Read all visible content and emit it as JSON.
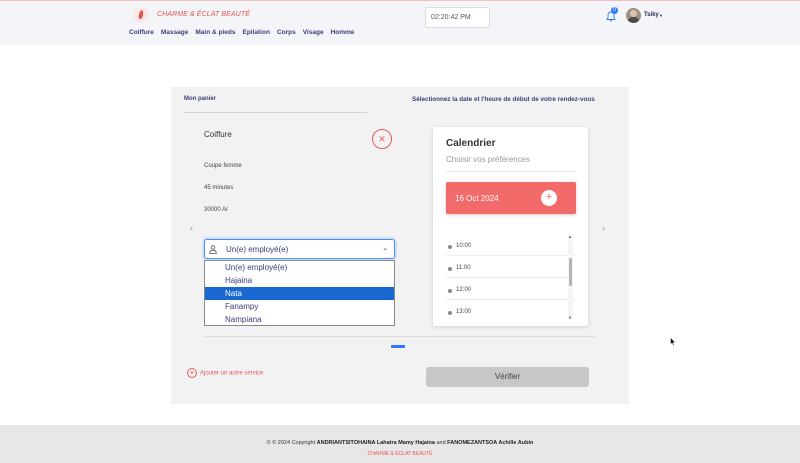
{
  "header": {
    "brand": "CHARME & ÉCLAT BEAUTÉ",
    "nav": [
      "Coiffure",
      "Massage",
      "Main & pieds",
      "Epilation",
      "Corps",
      "Visage",
      "Homme"
    ],
    "clock": "02:20:42 PM",
    "notification_count": "0",
    "user_name": "Tsiky"
  },
  "cart": {
    "title": "Mon panier",
    "service_name": "Coiffure",
    "service_type": "Coupe femme",
    "duration": "45 minutes",
    "price": "30000 Ar",
    "employee_select": {
      "selected": "Un(e) employé(e)",
      "options": [
        "Un(e) employé(e)",
        "Hajaina",
        "Nata",
        "Fanampy",
        "Nampiana"
      ],
      "highlighted": "Nata"
    },
    "add_service": "Ajouter un autre service"
  },
  "scheduler": {
    "title": "Sélectionnez la date et l'heure de début de votre rendez-vous",
    "calendar_title": "Calendrier",
    "calendar_subtitle": "Choisir vos préférences",
    "date": "16 Oct 2024",
    "times": [
      "10:00",
      "11:00",
      "12:00",
      "13:00"
    ],
    "verify_button": "Vérifier"
  },
  "footer": {
    "copyright_prefix": "© © 2024 Copyright",
    "author1": "ANDRIANTSITOHAINA Lahatra Mamy Hajaina",
    "and": "and",
    "author2": "FANOMEZANTSOA Achille Aubin",
    "brand": "CHARME & ÉCLAT BEAUTÉ"
  },
  "colors": {
    "accent": "#e55b5b",
    "nav_text": "#3b3f7a",
    "selection_blue": "#1967d2",
    "date_box": "#f26a6a"
  },
  "icons": [
    "logo-icon",
    "bell-icon",
    "user-icon",
    "close-icon",
    "chevron-down-icon",
    "plus-icon",
    "chevron-left-icon",
    "chevron-right-icon"
  ]
}
